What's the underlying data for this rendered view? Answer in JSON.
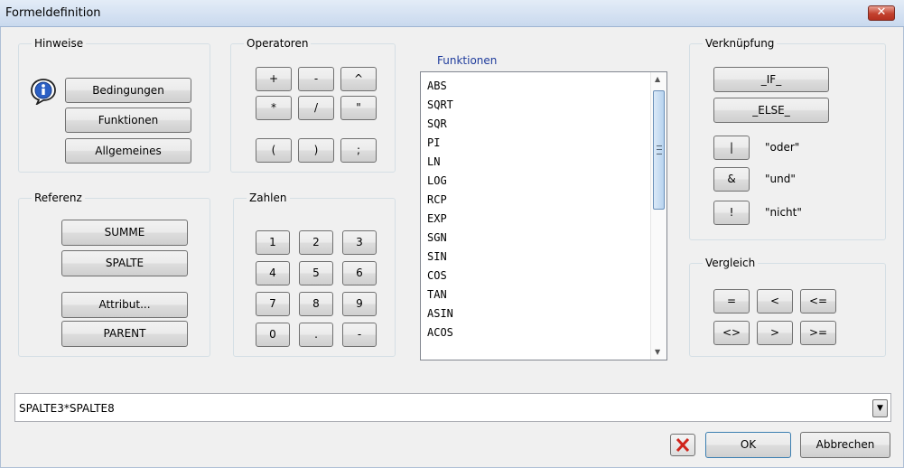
{
  "window": {
    "title": "Formeldefinition",
    "close_glyph": "✕"
  },
  "hinweise": {
    "legend": "Hinweise",
    "icon": "info-icon",
    "buttons": [
      "Bedingungen",
      "Funktionen",
      "Allgemeines"
    ]
  },
  "operatoren": {
    "legend": "Operatoren",
    "row1": [
      "+",
      "-",
      "^"
    ],
    "row2": [
      "*",
      "/",
      "\""
    ],
    "row3": [
      "(",
      ")",
      ";"
    ]
  },
  "funktionen": {
    "label": "Funktionen",
    "items": [
      "ABS",
      "SQRT",
      "SQR",
      "PI",
      "LN",
      "LOG",
      "RCP",
      "EXP",
      "SGN",
      "SIN",
      "COS",
      "TAN",
      "ASIN",
      "ACOS"
    ]
  },
  "verknuepfung": {
    "legend": "Verknüpfung",
    "if_label": "_IF_",
    "else_label": "_ELSE_",
    "logic": [
      {
        "symbol": "|",
        "text": "\"oder\""
      },
      {
        "symbol": "&",
        "text": "\"und\""
      },
      {
        "symbol": "!",
        "text": "\"nicht\""
      }
    ]
  },
  "referenz": {
    "legend": "Referenz",
    "buttons": [
      "SUMME",
      "SPALTE",
      "Attribut...",
      "PARENT"
    ]
  },
  "zahlen": {
    "legend": "Zahlen",
    "rows": [
      [
        "1",
        "2",
        "3"
      ],
      [
        "4",
        "5",
        "6"
      ],
      [
        "7",
        "8",
        "9"
      ],
      [
        "0",
        ".",
        "-"
      ]
    ]
  },
  "vergleich": {
    "legend": "Vergleich",
    "row1": [
      "=",
      "<",
      "<="
    ],
    "row2": [
      "<>",
      ">",
      ">="
    ]
  },
  "formula": {
    "value": "SPALTE3*SPALTE8"
  },
  "footer": {
    "ok_label": "OK",
    "cancel_label": "Abbrechen"
  },
  "colors": {
    "accent_link": "#1f3c9c",
    "cancel_x": "#d0241b",
    "title_gradient": "#c9d9ee",
    "close_red": "#c3412e"
  }
}
